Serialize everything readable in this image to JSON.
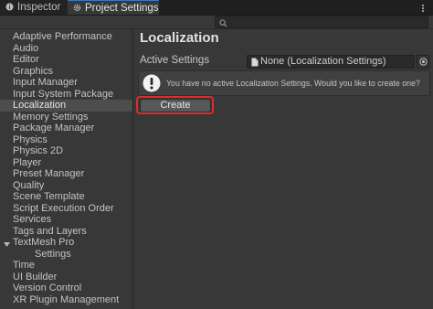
{
  "tabs": [
    {
      "label": "Inspector",
      "icon": "info-icon",
      "active": false
    },
    {
      "label": "Project Settings",
      "icon": "gear-icon",
      "active": true
    }
  ],
  "search": {
    "placeholder": ""
  },
  "sidebar": {
    "items": [
      {
        "label": "Adaptive Performance"
      },
      {
        "label": "Audio"
      },
      {
        "label": "Editor"
      },
      {
        "label": "Graphics"
      },
      {
        "label": "Input Manager"
      },
      {
        "label": "Input System Package"
      },
      {
        "label": "Localization",
        "selected": true
      },
      {
        "label": "Memory Settings"
      },
      {
        "label": "Package Manager"
      },
      {
        "label": "Physics"
      },
      {
        "label": "Physics 2D"
      },
      {
        "label": "Player"
      },
      {
        "label": "Preset Manager"
      },
      {
        "label": "Quality"
      },
      {
        "label": "Scene Template"
      },
      {
        "label": "Script Execution Order"
      },
      {
        "label": "Services"
      },
      {
        "label": "Tags and Layers"
      },
      {
        "label": "TextMesh Pro",
        "expanded": true
      },
      {
        "label": "Settings",
        "child": true
      },
      {
        "label": "Time"
      },
      {
        "label": "UI Builder"
      },
      {
        "label": "Version Control"
      },
      {
        "label": "XR Plugin Management"
      }
    ]
  },
  "main": {
    "title": "Localization",
    "active_settings_label": "Active Settings",
    "active_settings_value": "None (Localization Settings)",
    "help_message": "You have no active Localization Settings. Would you like to create one?",
    "create_label": "Create"
  },
  "colors": {
    "highlight": "#dd2c2c",
    "selected_row": "#4d4d4d",
    "active_tab_accent": "#3a79bb"
  }
}
